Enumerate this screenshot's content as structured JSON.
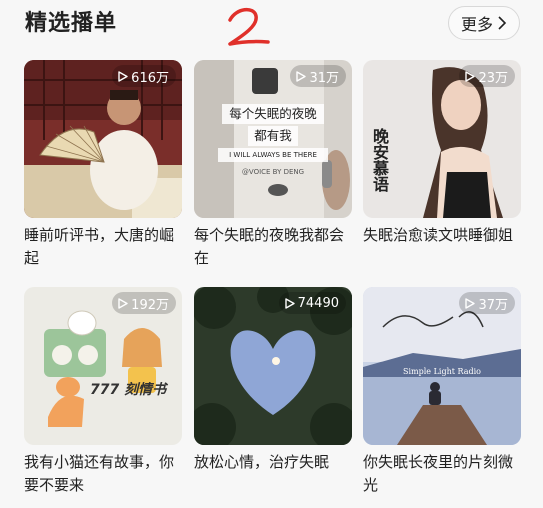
{
  "section": {
    "title": "精选播单",
    "more_label": "更多",
    "handwritten_mark": "2"
  },
  "playlists": [
    {
      "plays": "616万",
      "title": "睡前听评书，大唐的崛起",
      "cover_icon": "storyteller-with-fan"
    },
    {
      "plays": "31万",
      "title": "每个失眠的夜晚我都会在",
      "cover_icon": "hands-holding-watch",
      "cover_text_line1": "每个失眠的夜晚",
      "cover_text_line2": "都有我",
      "cover_text_en": "I WILL ALWAYS BE THERE",
      "cover_credit": "@VOICE BY DENG"
    },
    {
      "plays": "23万",
      "title": "失眠治愈读文哄睡御姐",
      "cover_icon": "woman-portrait",
      "cover_text_vertical": "晚安慕语"
    },
    {
      "plays": "192万",
      "title": "我有小猫还有故事，你要不要来",
      "cover_icon": "cartoon-cat-radio",
      "cover_text": "777 刻情书"
    },
    {
      "plays": "74490",
      "title": "放松心情，治疗失眠",
      "cover_icon": "heart-shaped-sky"
    },
    {
      "plays": "37万",
      "title": "你失眠长夜里的片刻微光",
      "cover_icon": "person-on-pier",
      "cover_text": "Simple Light Radio"
    }
  ],
  "colors": {
    "background": "#f7f7f7",
    "text": "#222222",
    "mark": "#e0302a"
  }
}
